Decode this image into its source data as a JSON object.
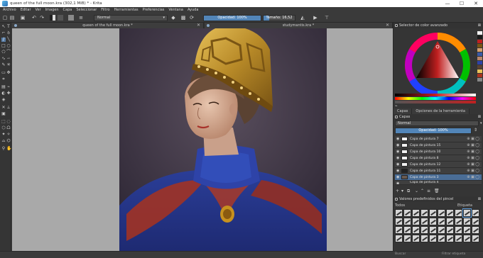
{
  "window": {
    "title": "queen of the full moon.kra (302,1 MiB) * - Krita",
    "minimize": "—",
    "maximize": "☐",
    "close": "✕"
  },
  "menu": [
    "Archivo",
    "Editar",
    "Ver",
    "Imagen",
    "Capa",
    "Seleccionar",
    "Filtro",
    "Herramientas",
    "Preferencias",
    "Ventana",
    "Ayuda"
  ],
  "toolbar": {
    "blend_mode": "Normal",
    "opacity_label": "Opacidad: 100%",
    "opacity_value": 1.0,
    "size_label": "Tamaño: 16,52 px",
    "size_fraction": 0.18
  },
  "tabs": [
    {
      "label": "queen of the full moon.kra *",
      "close": "✕"
    },
    {
      "label": "studymantis.kra *",
      "close": "✕"
    }
  ],
  "docker": {
    "color_selector_title": "Selector de color avanzado",
    "tabs": [
      "Capas",
      "Opciones de la herramienta"
    ],
    "layers_title": "Capas",
    "blend_mode": "Normal",
    "opacity_label": "Opacidad: 100%",
    "layers": [
      {
        "name": "Capa de pintura 7",
        "active": false
      },
      {
        "name": "Capa de pintura 15",
        "active": false
      },
      {
        "name": "Capa de pintura 10",
        "active": false
      },
      {
        "name": "Capa de pintura 8",
        "active": false
      },
      {
        "name": "Capa de pintura 12",
        "active": false
      },
      {
        "name": "Capa de pintura 11",
        "active": false
      },
      {
        "name": "Capa de pintura 3",
        "active": true
      },
      {
        "name": "Capa de pintura 4",
        "active": false
      }
    ],
    "presets_title": "Valores predefinidos del pincel",
    "presets_filter": "Todos",
    "presets_tag": "Etiqueta"
  },
  "statusbar": {
    "search_hint": "Buscar",
    "filter_hint": "Filtrar etiqueta"
  },
  "colors": {
    "accent": "#5285b8",
    "panel": "#353535",
    "canvas_bg": "#a9a9a9",
    "fg_swatch": "#c02020"
  }
}
